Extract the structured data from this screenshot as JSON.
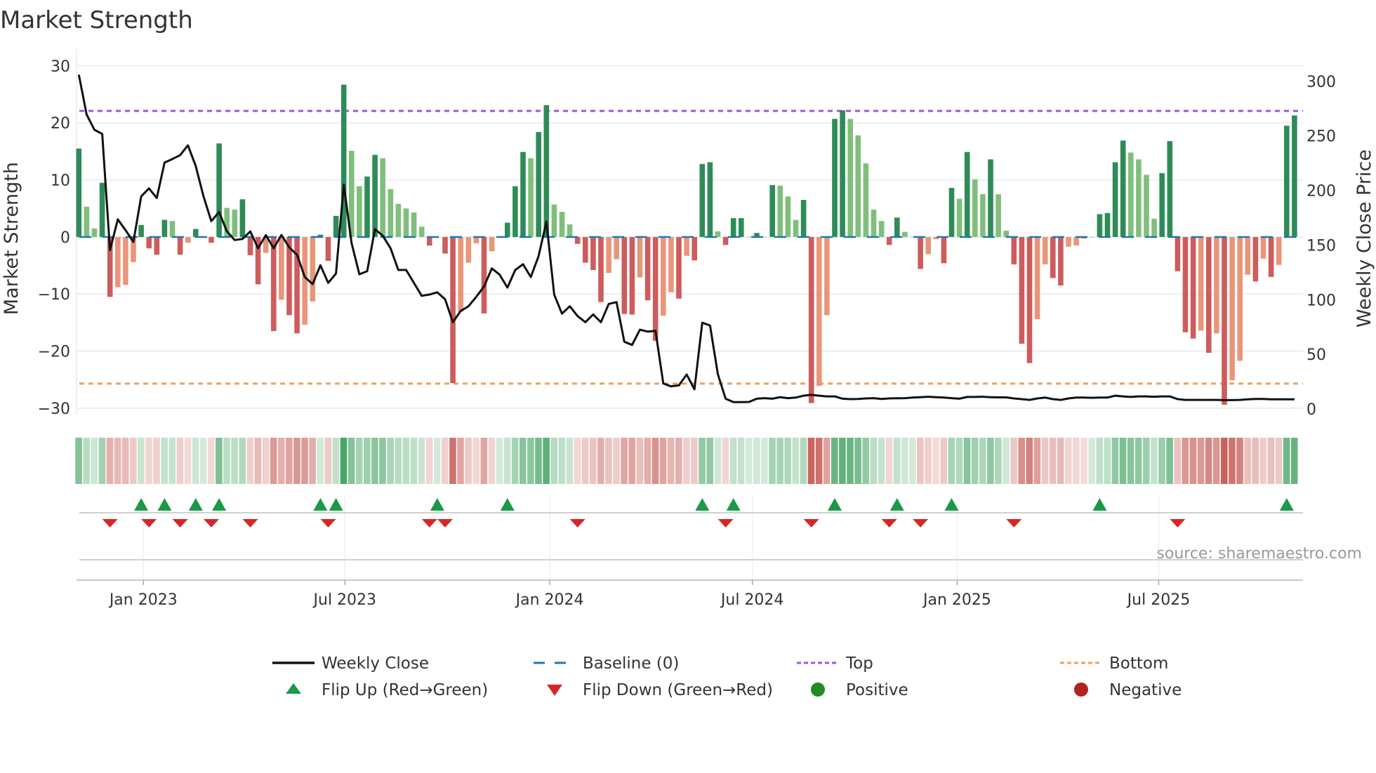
{
  "chart_data": {
    "type": "bar",
    "title": "Market Strength",
    "ylabel": "Market Strength",
    "y2label": "Weekly Close Price",
    "ylim": [
      -31,
      31.7
    ],
    "y2lim": [
      -4.5,
      323
    ],
    "yticks": [
      "30",
      "20",
      "10",
      "0",
      "−10",
      "−20",
      "−30"
    ],
    "yticks_values": [
      30,
      20,
      10,
      0,
      -10,
      -20,
      -30
    ],
    "y2ticks": [
      "300",
      "250",
      "200",
      "150",
      "100",
      "50",
      "0"
    ],
    "y2ticks_values": [
      300,
      250,
      200,
      150,
      100,
      50,
      0
    ],
    "x_start_date": "2022-11-04",
    "x_step_days": 7,
    "xticks": [
      {
        "label": "Jan 2023",
        "date": "2023-01-01"
      },
      {
        "label": "Jul 2023",
        "date": "2023-07-01"
      },
      {
        "label": "Jan 2024",
        "date": "2024-01-01"
      },
      {
        "label": "Jul 2024",
        "date": "2024-07-01"
      },
      {
        "label": "Jan 2025",
        "date": "2025-01-01"
      },
      {
        "label": "Jul 2025",
        "date": "2025-07-01"
      }
    ],
    "top_level": 22.1,
    "bottom_level": -25.7,
    "strength": [
      15.5,
      5.3,
      1.5,
      9.5,
      -10.5,
      -8.8,
      -8.4,
      -4.4,
      2.1,
      -2,
      -3.1,
      3.0,
      2.8,
      -3.1,
      -1,
      1.4,
      0,
      -1,
      16.4,
      5.1,
      4.8,
      6.6,
      -3.2,
      -8.3,
      -2.8,
      -16.5,
      -11,
      -13.7,
      -16.9,
      -15.4,
      -11.3,
      0.4,
      -4.2,
      3.7,
      26.7,
      15.1,
      8.9,
      10.6,
      14.4,
      13.8,
      8.4,
      5.8,
      5.0,
      4.3,
      1.8,
      -1.5,
      0,
      -2.9,
      -25.6,
      -13.1,
      -4.5,
      -1.1,
      -13.4,
      -2.5,
      0,
      2.5,
      8.9,
      14.9,
      13.8,
      18.4,
      23.1,
      5.7,
      4.4,
      2.2,
      -1.2,
      -4.5,
      -5.8,
      -11.4,
      -6.3,
      -3.9,
      -13.5,
      -13.6,
      -7.1,
      -11.1,
      -18.2,
      -13.8,
      -9.7,
      -10.8,
      -3.3,
      -4.1,
      12.8,
      13.1,
      1.0,
      -1.4,
      3.3,
      3.3,
      0,
      0.7,
      0,
      9.1,
      9.0,
      7.1,
      3.0,
      6.5,
      -29.1,
      -26.1,
      -13.7,
      20.7,
      22.2,
      20.7,
      17.8,
      12.9,
      4.8,
      2.8,
      -1.4,
      3.4,
      0.9,
      0,
      -5.6,
      -3.0,
      -0.4,
      -4.6,
      8.6,
      6.7,
      14.9,
      10.1,
      7.5,
      13.6,
      7.5,
      1.1,
      -4.8,
      -18.7,
      -22.1,
      -14.4,
      -4.8,
      -7.2,
      -8.5,
      -1.7,
      -1.5,
      -0.3,
      0,
      4.0,
      4.2,
      13.1,
      16.9,
      14.8,
      13.6,
      10.9,
      3.2,
      11.2,
      16.8,
      -6,
      -16.7,
      -17.8,
      -16.4,
      -20.3,
      -16.9,
      -29.4,
      -25.1,
      -21.7,
      -6.6,
      -7.8,
      -3.8,
      -7.0,
      -4.9,
      19.5,
      21.3
    ],
    "tone": [
      "P",
      "p",
      "p",
      "P",
      "N",
      "n",
      "n",
      "n",
      "P",
      "N",
      "N",
      "P",
      "p",
      "N",
      "n",
      "P",
      "Z",
      "N",
      "P",
      "p",
      "p",
      "P",
      "N",
      "N",
      "n",
      "N",
      "n",
      "N",
      "N",
      "n",
      "n",
      "P",
      "N",
      "P",
      "P",
      "p",
      "p",
      "P",
      "P",
      "p",
      "p",
      "p",
      "p",
      "p",
      "p",
      "N",
      "Z",
      "N",
      "N",
      "n",
      "n",
      "n",
      "N",
      "n",
      "Z",
      "P",
      "P",
      "P",
      "p",
      "P",
      "P",
      "p",
      "p",
      "p",
      "N",
      "N",
      "N",
      "N",
      "n",
      "n",
      "N",
      "N",
      "n",
      "N",
      "N",
      "n",
      "n",
      "N",
      "n",
      "N",
      "P",
      "P",
      "p",
      "N",
      "P",
      "P",
      "Z",
      "P",
      "Z",
      "P",
      "p",
      "p",
      "p",
      "P",
      "N",
      "n",
      "n",
      "P",
      "P",
      "p",
      "p",
      "p",
      "p",
      "p",
      "N",
      "P",
      "p",
      "Z",
      "N",
      "n",
      "n",
      "N",
      "P",
      "p",
      "P",
      "p",
      "p",
      "P",
      "p",
      "p",
      "N",
      "N",
      "N",
      "n",
      "n",
      "N",
      "N",
      "n",
      "n",
      "n",
      "Z",
      "P",
      "P",
      "P",
      "P",
      "p",
      "p",
      "p",
      "p",
      "P",
      "P",
      "N",
      "N",
      "N",
      "n",
      "N",
      "n",
      "N",
      "n",
      "n",
      "n",
      "N",
      "n",
      "N",
      "n",
      "P",
      "P"
    ],
    "weekly_close": [
      306,
      269.5,
      255.6,
      251.8,
      145.4,
      173.6,
      163.6,
      152.9,
      194.6,
      201.9,
      193.1,
      225.6,
      228.8,
      232.3,
      241.3,
      222.4,
      194.6,
      171.9,
      180.3,
      162.5,
      154.6,
      155.6,
      162.5,
      147.1,
      159.1,
      147.1,
      159.3,
      147.9,
      141.1,
      120.7,
      114.3,
      131.5,
      115.4,
      124,
      205.3,
      151.8,
      123.3,
      126.1,
      164.6,
      158.6,
      147.1,
      127.2,
      127.2,
      115.4,
      103.6,
      104.7,
      106.8,
      100.4,
      79.4,
      89.7,
      94,
      102.6,
      112.2,
      128.6,
      122.9,
      111.1,
      127.2,
      132.5,
      120.7,
      140,
      171.5,
      104.7,
      87.2,
      94,
      85,
      79.4,
      86.5,
      79.4,
      96.1,
      97.8,
      61.5,
      58.6,
      72.6,
      70.8,
      71.5,
      23.3,
      20.7,
      21.6,
      31.5,
      18,
      79,
      76.4,
      31.9,
      9.4,
      6.2,
      6.2,
      6.4,
      9.4,
      9.9,
      9.4,
      10.8,
      9.9,
      10.4,
      12.1,
      12.9,
      12.1,
      11.5,
      11.5,
      9.4,
      9,
      9.2,
      9.6,
      9.9,
      9.2,
      9.6,
      9.8,
      9.9,
      10.4,
      10.8,
      11.2,
      10.8,
      10.4,
      9.9,
      9.4,
      11,
      11,
      11.2,
      10.8,
      10.6,
      10.6,
      9.6,
      9,
      8.3,
      9.6,
      10.4,
      9,
      8.3,
      9.6,
      10.4,
      10.4,
      10.2,
      10.4,
      10.4,
      12.1,
      11.5,
      11,
      11.5,
      11.5,
      11.2,
      11.5,
      11.5,
      9,
      8.3,
      8.3,
      8.3,
      8.3,
      8.3,
      8.1,
      8.1,
      8.3,
      8.8,
      9.2,
      9.2,
      8.8,
      8.8,
      8.8,
      8.8
    ],
    "flip_up_weeks": [
      8,
      11,
      15,
      18,
      31,
      33,
      46,
      55,
      80,
      84,
      97,
      105,
      112,
      131,
      155
    ],
    "flip_down_weeks": [
      4,
      9,
      13,
      17,
      22,
      32,
      45,
      47,
      64,
      83,
      94,
      104,
      108,
      120,
      141
    ],
    "colors": {
      "strong_positive": "#2e8b57",
      "weak_positive": "#7fbf7b",
      "strong_negative": "#cd5c5c",
      "weak_negative": "#e8967a",
      "baseline": "#1f77b4",
      "top": "#9b59d9",
      "bottom": "#f0a05a",
      "price": "#111111",
      "flip_up": "#1a9a48",
      "flip_down": "#d62728",
      "positive": "#228b22",
      "negative": "#b22222"
    },
    "legend": [
      {
        "label": "Weekly Close",
        "kind": "line"
      },
      {
        "label": "Baseline (0)",
        "kind": "dash"
      },
      {
        "label": "Top",
        "kind": "dot-top"
      },
      {
        "label": "Bottom",
        "kind": "dot-bottom"
      },
      {
        "label": "Flip Up (Red→Green)",
        "kind": "tri-up"
      },
      {
        "label": "Flip Down (Green→Red)",
        "kind": "tri-down"
      },
      {
        "label": "Positive",
        "kind": "dot-pos"
      },
      {
        "label": "Negative",
        "kind": "dot-neg"
      }
    ],
    "source": "source: sharemaestro.com"
  }
}
